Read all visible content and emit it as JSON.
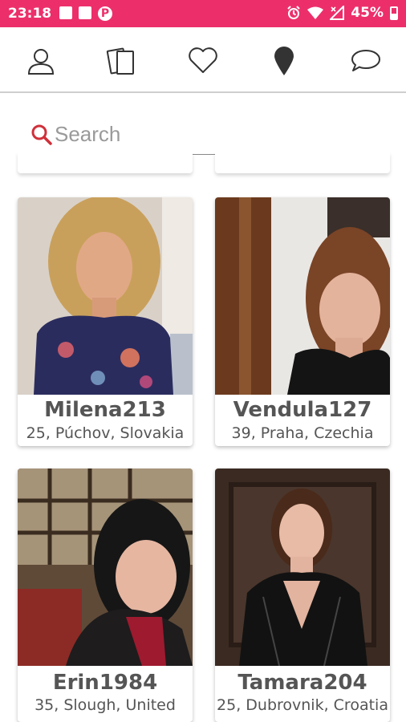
{
  "status_bar": {
    "time": "23:18",
    "battery": "45%"
  },
  "nav": {
    "items": [
      {
        "name": "profile-icon"
      },
      {
        "name": "cards-icon"
      },
      {
        "name": "heart-icon"
      },
      {
        "name": "location-pin-icon"
      },
      {
        "name": "chat-icon"
      }
    ]
  },
  "search": {
    "placeholder": "Search"
  },
  "profiles": [
    {
      "name": "Milena213",
      "info": "25, Púchov, Slovakia"
    },
    {
      "name": "Vendula127",
      "info": "39, Praha, Czechia"
    },
    {
      "name": "Erin1984",
      "info": "35, Slough, United"
    },
    {
      "name": "Tamara204",
      "info": "25, Dubrovnik, Croatia"
    }
  ],
  "colors": {
    "accent": "#ec2f6b",
    "search_icon": "#d0303a"
  }
}
